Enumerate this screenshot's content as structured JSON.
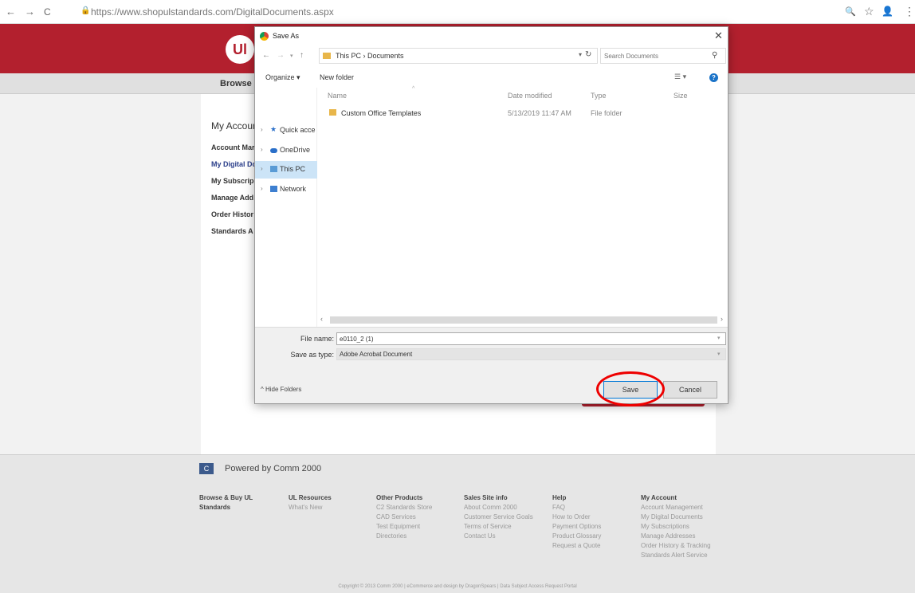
{
  "browser": {
    "url": "https://www.shopulstandards.com/DigitalDocuments.aspx",
    "icons": {
      "back": "←",
      "forward": "→",
      "reload": "C",
      "lock": "🔒",
      "zoom": "🔍",
      "star": "☆",
      "account": "👤",
      "menu": "⋮"
    }
  },
  "site": {
    "logo": "Ul",
    "menu_browse": "Browse &",
    "account_title": "My Accoun",
    "account_links": [
      "Account Mar",
      "My Digital Dc",
      "My Subscrip",
      "Manage Add",
      "Order Histor",
      "Standards A"
    ],
    "brand_color": "#b3202e"
  },
  "footer": {
    "powered": "Powered by Comm 2000",
    "columns": [
      {
        "head": "Browse & Buy UL Standards",
        "items": []
      },
      {
        "head": "UL Resources",
        "items": [
          "What's New"
        ]
      },
      {
        "head": "Other Products",
        "items": [
          "C2 Standards Store",
          "CAD Services",
          "Test Equipment",
          "Directories"
        ]
      },
      {
        "head": "Sales Site info",
        "items": [
          "About Comm 2000",
          "Customer Service Goals",
          "Terms of Service",
          "Contact Us"
        ]
      },
      {
        "head": "Help",
        "items": [
          "FAQ",
          "How to Order",
          "Payment Options",
          "Product Glossary",
          "Request a Quote"
        ]
      },
      {
        "head": "My Account",
        "items": [
          "Account Management",
          "My Digital Documents",
          "My Subscriptions",
          "Manage Addresses",
          "Order History & Tracking",
          "Standards Alert Service"
        ]
      }
    ],
    "copyright": "Copyright © 2013 Comm 2000 | eCommerce and design by DragonSpears | Data Subject Access Request Portal"
  },
  "dialog": {
    "title": "Save As",
    "path": "This PC › Documents",
    "search_placeholder": "Search Documents",
    "organize": "Organize ▾",
    "new_folder": "New folder",
    "nav_items": [
      "Quick acce",
      "OneDrive",
      "This PC",
      "Network"
    ],
    "columns": {
      "name": "Name",
      "date": "Date modified",
      "type": "Type",
      "size": "Size"
    },
    "files": [
      {
        "name": "Custom Office Templates",
        "date": "5/13/2019 11:47 AM",
        "type": "File folder"
      }
    ],
    "file_name_label": "File name:",
    "file_name_value": "e0110_2 (1)",
    "save_type_label": "Save as type:",
    "save_type_value": "Adobe Acrobat Document",
    "hide_folders": "Hide Folders",
    "save": "Save",
    "cancel": "Cancel"
  }
}
